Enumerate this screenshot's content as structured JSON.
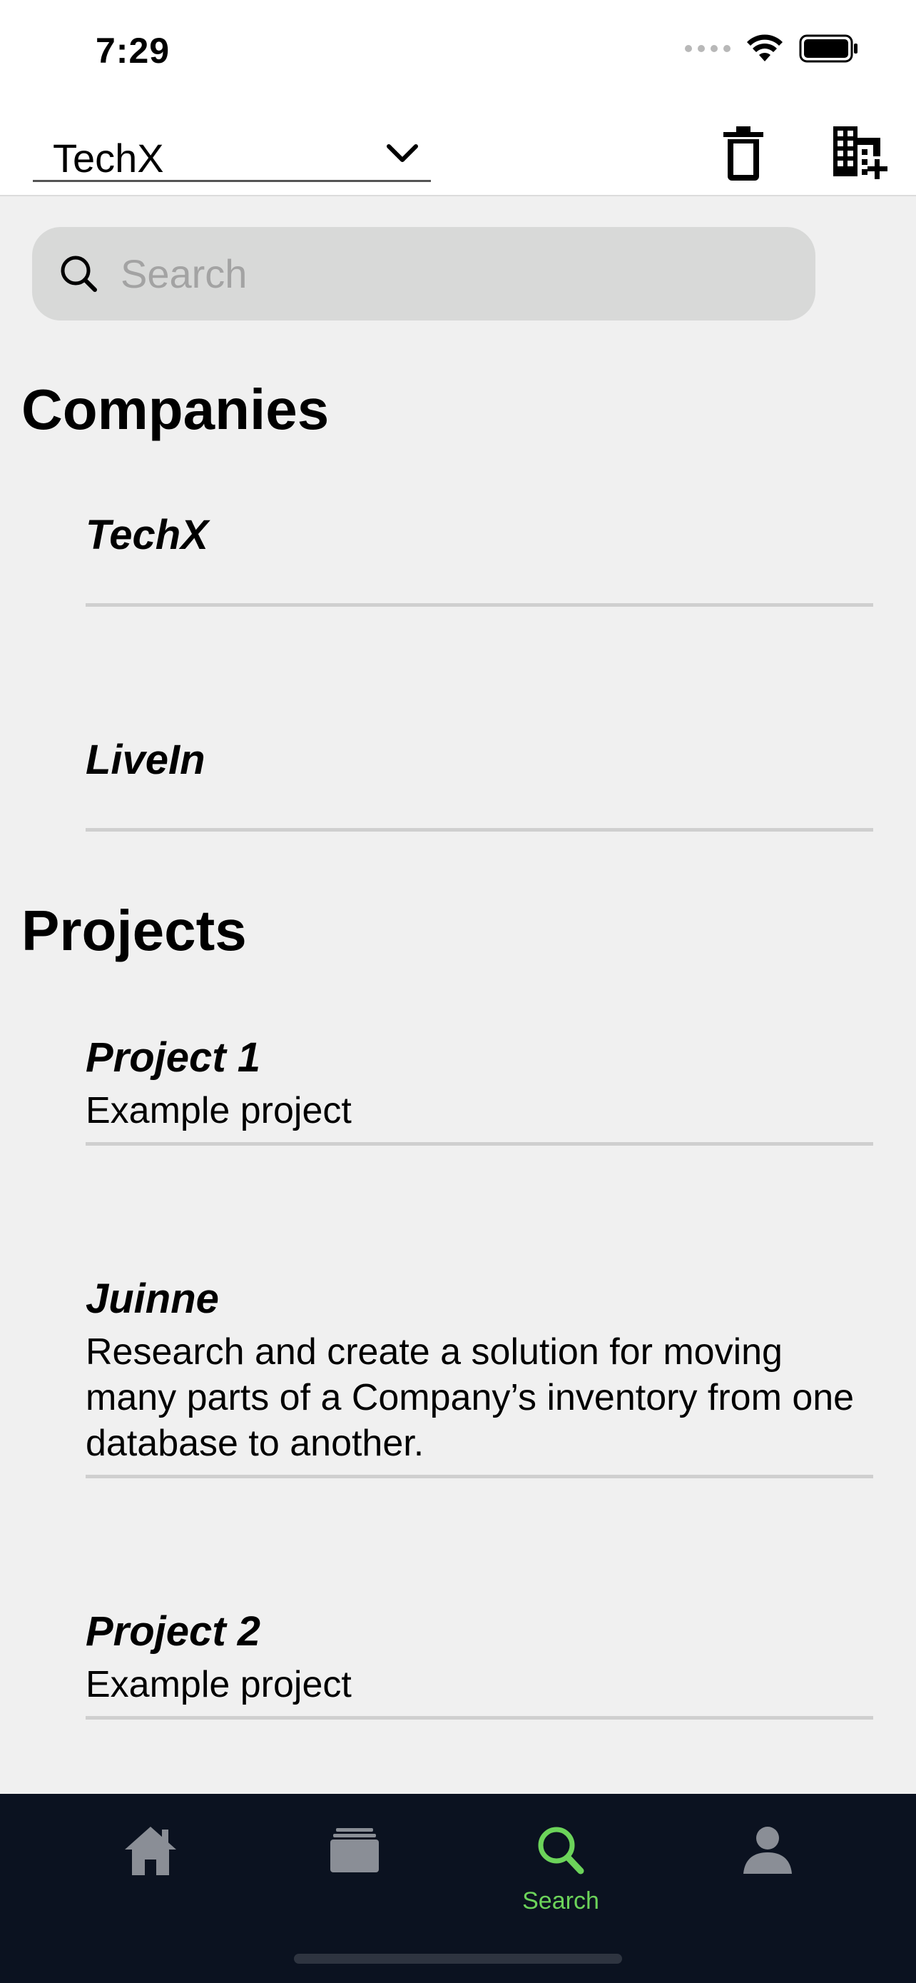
{
  "status": {
    "time": "7:29"
  },
  "header": {
    "selected_company": "TechX"
  },
  "search": {
    "placeholder": "Search",
    "value": ""
  },
  "companies": {
    "title": "Companies",
    "items": [
      {
        "name": "TechX"
      },
      {
        "name": "LiveIn"
      }
    ]
  },
  "projects": {
    "title": "Projects",
    "items": [
      {
        "name": "Project 1",
        "description": "Example project"
      },
      {
        "name": "Juinne",
        "description": "Research and create a solution for moving many parts of a Company’s inventory from one database to another."
      },
      {
        "name": "Project 2",
        "description": "Example project"
      }
    ]
  },
  "tabs": [
    {
      "icon": "home-icon",
      "label": ""
    },
    {
      "icon": "stack-icon",
      "label": ""
    },
    {
      "icon": "search-icon",
      "label": "Search",
      "active": true
    },
    {
      "icon": "person-icon",
      "label": ""
    }
  ],
  "colors": {
    "accent": "#6cd35a",
    "tab_bar": "#0b1220",
    "inactive_icon": "#8a8e96"
  }
}
